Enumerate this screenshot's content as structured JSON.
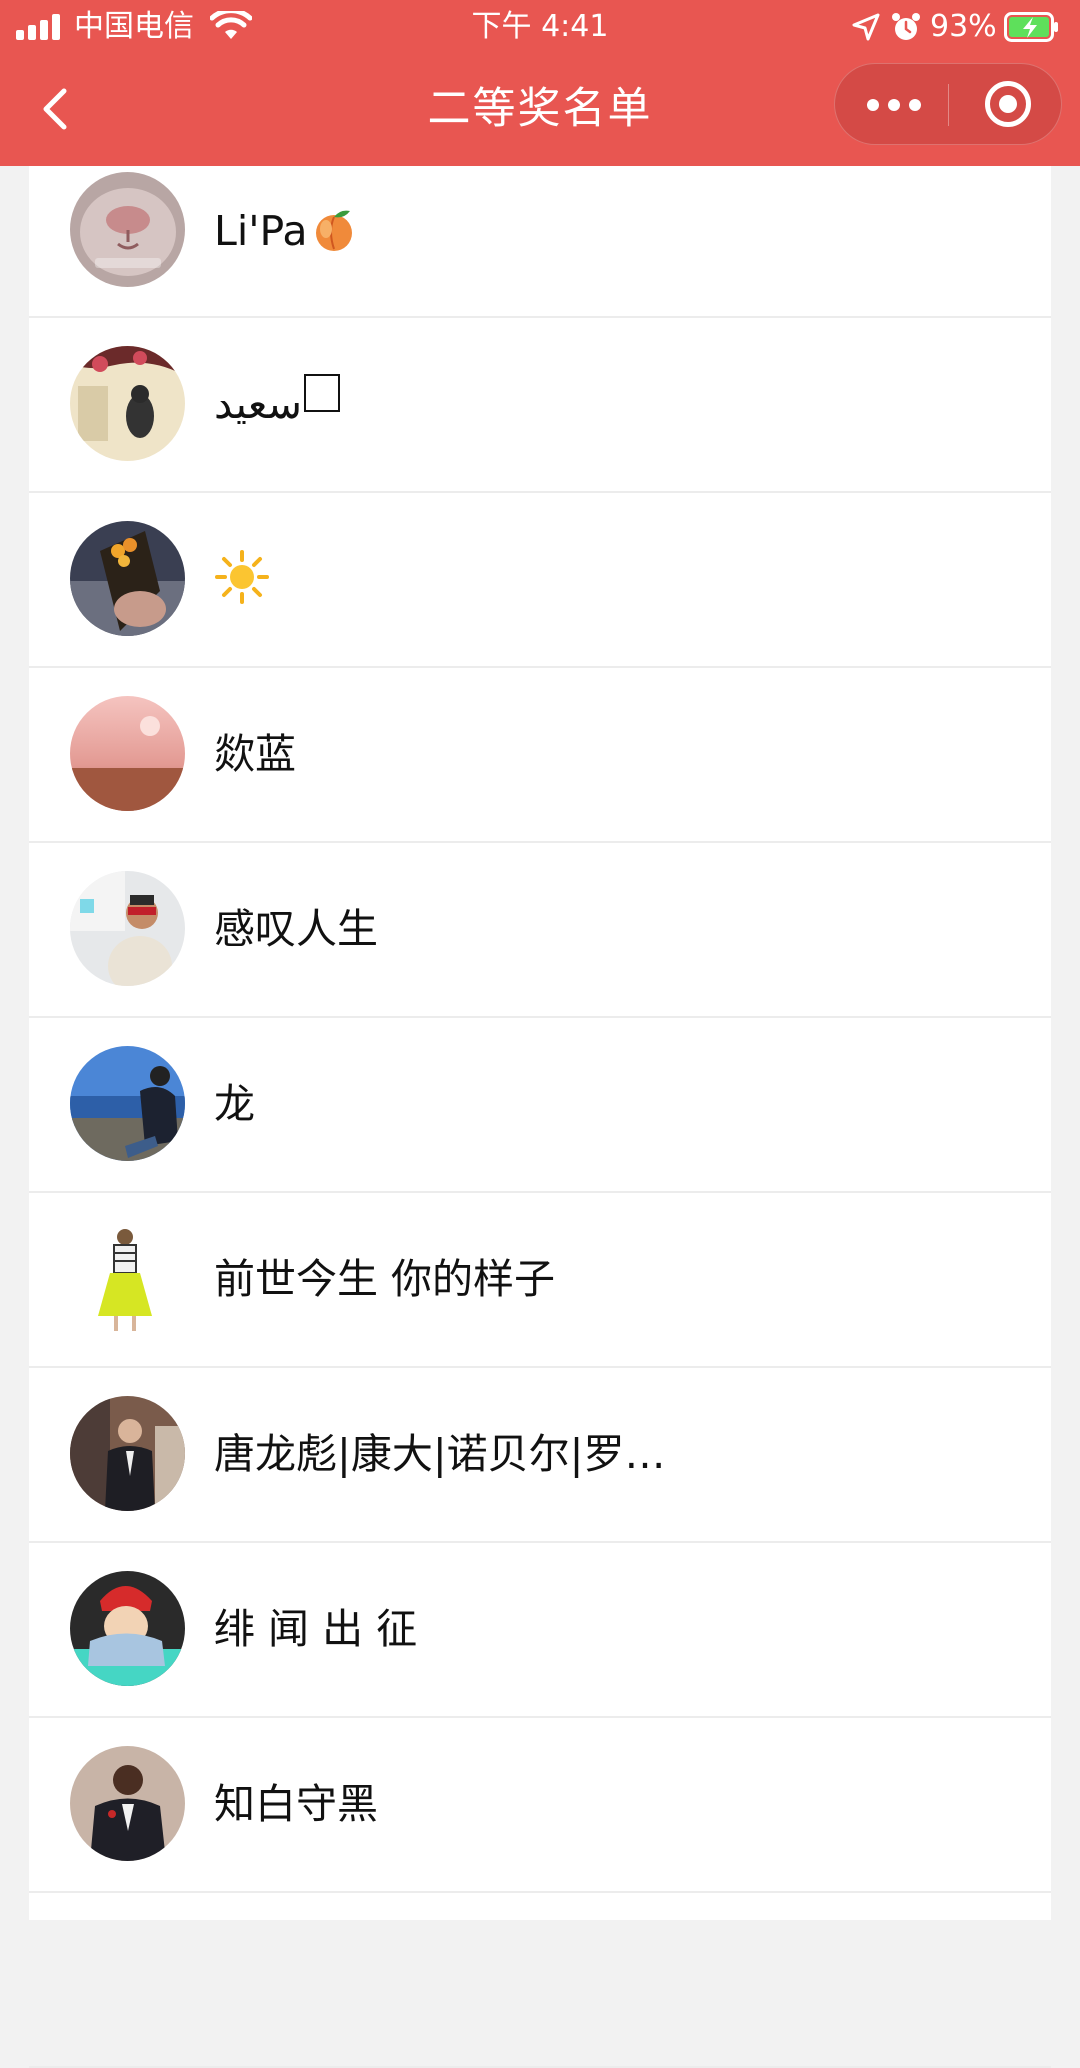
{
  "status_bar": {
    "carrier": "中国电信",
    "time": "下午 4:41",
    "battery": "93%",
    "icons": [
      "signal-icon",
      "wifi-icon",
      "location-icon",
      "alarm-icon",
      "battery-icon"
    ]
  },
  "nav": {
    "title": "二等奖名单",
    "back_icon": "chevron-left-icon",
    "more_icon": "more-dots-icon",
    "close_icon": "close-circle-icon"
  },
  "colors": {
    "nav_background": "#e85651",
    "page_background": "#f2f2f2",
    "list_background": "#ffffff",
    "divider": "#ececec"
  },
  "winners": [
    {
      "name": "Li'Pa",
      "emoji": "peach",
      "avatar": "cat-nose-photo"
    },
    {
      "name": "سعيد",
      "glyph": "box",
      "avatar": "girl-with-flowers-photo"
    },
    {
      "name": "",
      "emoji": "sun",
      "avatar": "girl-with-bouquet-photo"
    },
    {
      "name": "欻蓝",
      "avatar": "pink-sky-landscape-photo"
    },
    {
      "name": "感叹人生",
      "avatar": "man-with-sunglasses-photo"
    },
    {
      "name": "龙",
      "avatar": "man-on-beach-photo"
    },
    {
      "name": "前世今生 你的样子",
      "avatar": "fashion-illustration"
    },
    {
      "name": "唐龙彪|康大|诺贝尔|罗…",
      "avatar": "man-in-suit-photo"
    },
    {
      "name": "绯 闻 出 征",
      "avatar": "baby-in-red-hat-photo"
    },
    {
      "name": "知白守黑",
      "avatar": "man-in-tuxedo-photo"
    },
    {
      "name": "",
      "avatar": ""
    }
  ]
}
